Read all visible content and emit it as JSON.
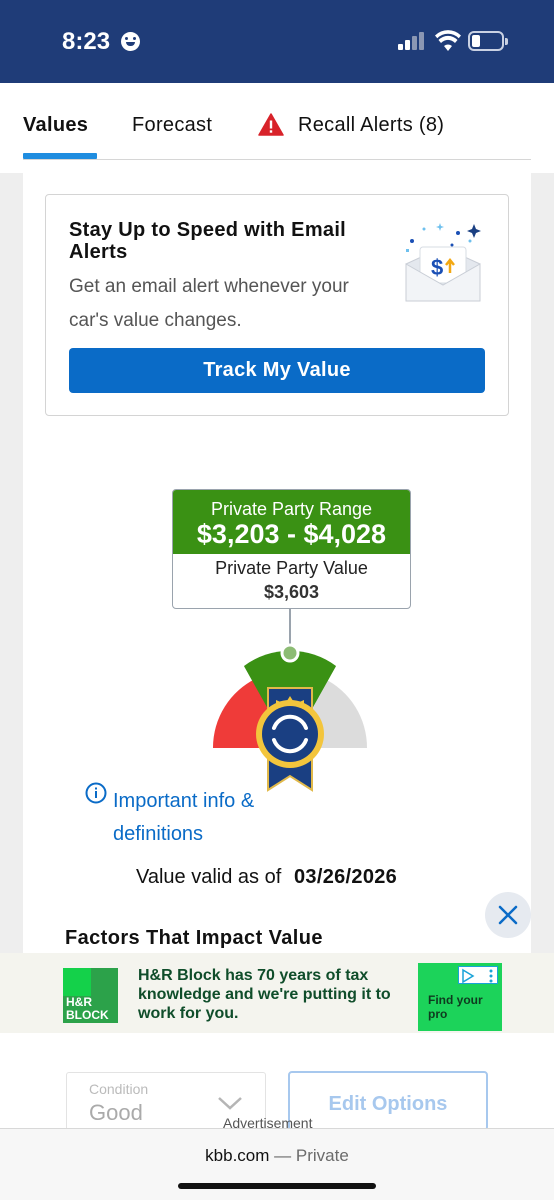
{
  "status_bar": {
    "time": "8:23"
  },
  "tabs": [
    {
      "label": "Values"
    },
    {
      "label": "Forecast"
    },
    {
      "label": "Recall Alerts (8)"
    }
  ],
  "email_card": {
    "title": "Stay Up to Speed with Email Alerts",
    "description": "Get an email alert whenever your car's value changes.",
    "button_label": "Track My Value"
  },
  "value_box": {
    "range_label": "Private Party Range",
    "range_value": "$3,203 - $4,028",
    "value_label": "Private Party Value",
    "value": "$3,603"
  },
  "info": {
    "link_text": "Important info & definitions"
  },
  "valid": {
    "label": "Value valid as of",
    "date": "03/26/2026"
  },
  "factors": {
    "title": "Factors That Impact Value"
  },
  "ad": {
    "brand": "H&R BLOCK",
    "text": "H&R Block has 70 years of tax knowledge and we're putting it to work for you.",
    "cta": "Find your pro"
  },
  "condition": {
    "label": "Condition",
    "value": "Good"
  },
  "edit_options": {
    "label": "Edit Options"
  },
  "advertisement_label": "Advertisement",
  "browser": {
    "domain": "kbb.com",
    "mode": "Private"
  },
  "colors": {
    "header": "#1f3c78",
    "accent_blue": "#0a6bc7",
    "range_green": "#3a9114",
    "ad_green": "#14d14a"
  }
}
